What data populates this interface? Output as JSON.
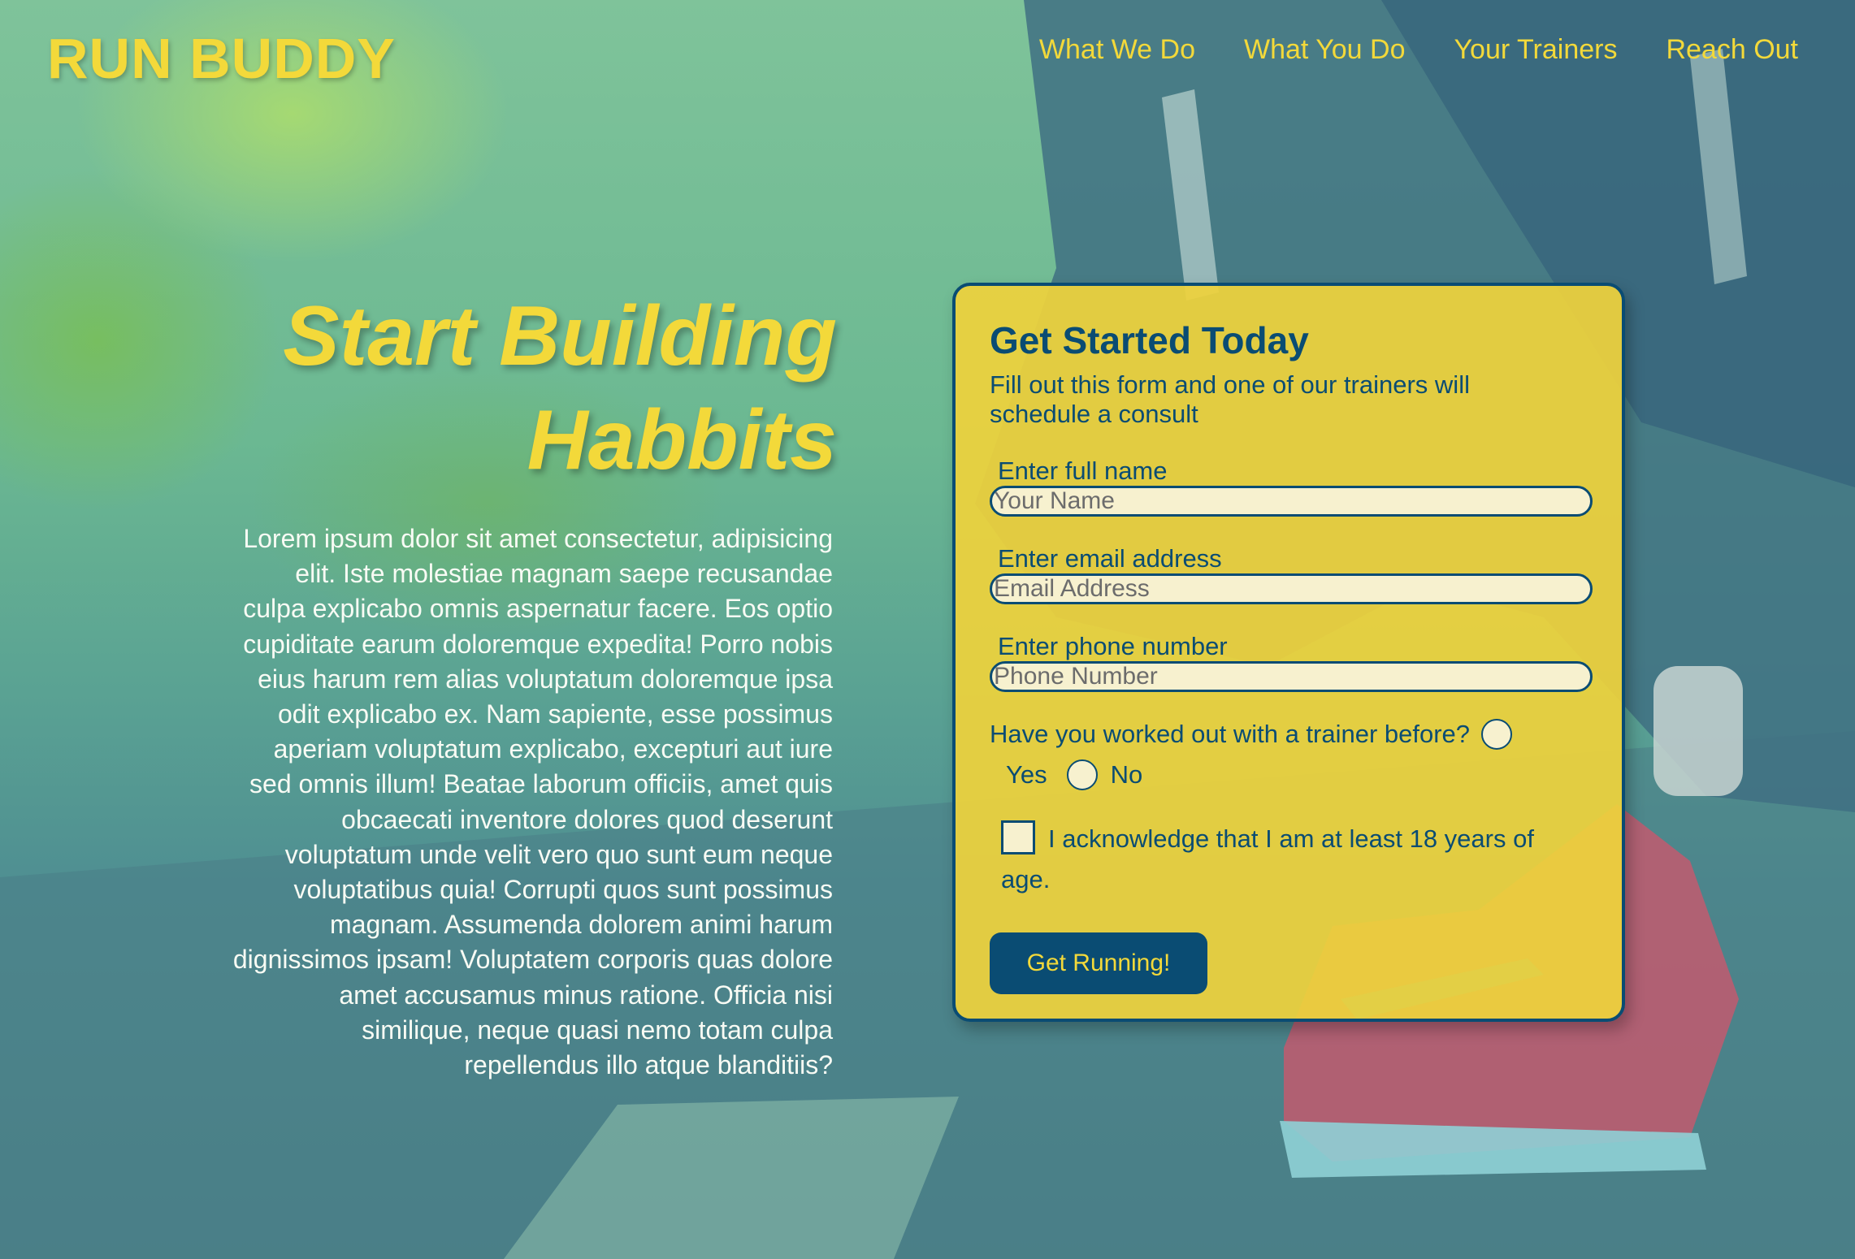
{
  "brand": {
    "name": "RUN BUDDY"
  },
  "nav": {
    "items": [
      {
        "label": "What We Do"
      },
      {
        "label": "What You Do"
      },
      {
        "label": "Your Trainers"
      },
      {
        "label": "Reach Out"
      }
    ]
  },
  "hero": {
    "title_line1": "Start Building",
    "title_line2": "Habbits",
    "body": "Lorem ipsum dolor sit amet consectetur, adipisicing elit. Iste molestiae magnam saepe recusandae culpa explicabo omnis aspernatur facere. Eos optio cupiditate earum doloremque expedita! Porro nobis eius harum rem alias voluptatum doloremque ipsa odit explicabo ex. Nam sapiente, esse possimus aperiam voluptatum explicabo, excepturi aut iure sed omnis illum! Beatae laborum officiis, amet quis obcaecati inventore dolores quod deserunt voluptatum unde velit vero quo sunt eum neque voluptatibus quia! Corrupti quos sunt possimus magnam. Assumenda dolorem animi harum dignissimos ipsam! Voluptatem corporis quas dolore amet accusamus minus ratione. Officia nisi similique, neque quasi nemo totam culpa repellendus illo atque blanditiis?"
  },
  "form": {
    "heading": "Get Started Today",
    "subheading": "Fill out this form and one of our trainers will schedule a consult",
    "name_label": "Enter full name",
    "name_placeholder": "Your Name",
    "email_label": "Enter email address",
    "email_placeholder": "Email Address",
    "phone_label": "Enter phone number",
    "phone_placeholder": "Phone Number",
    "trainer_question": "Have you worked out with a trainer before?",
    "option_yes": "Yes",
    "option_no": "No",
    "ack_line1": "I acknowledge that I am at least 18 years of",
    "ack_line2": "age.",
    "submit_label": "Get Running!"
  },
  "colors": {
    "accent_yellow": "#f3d93a",
    "navy": "#0a4c73",
    "card_yellow": "#eed23c"
  }
}
